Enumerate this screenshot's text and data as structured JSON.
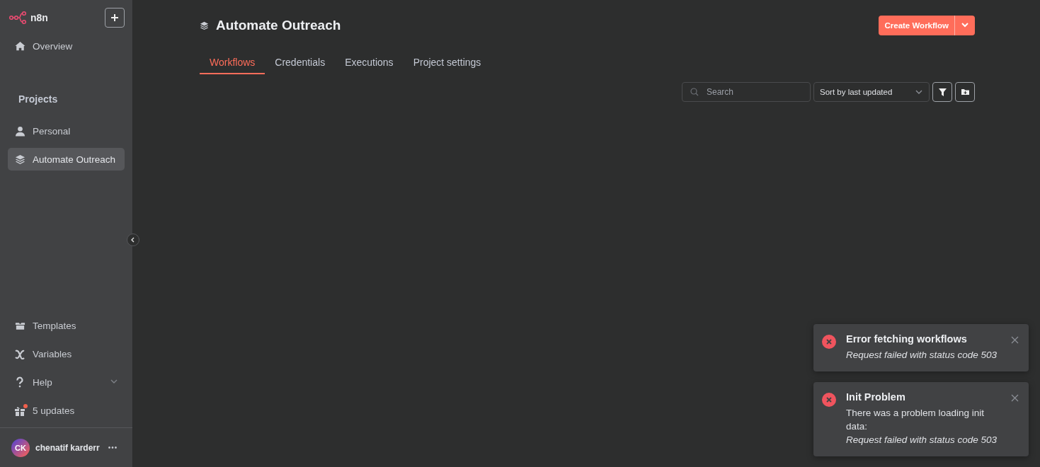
{
  "sidebar": {
    "logo": "n8n",
    "nav": [
      {
        "label": "Overview",
        "selected": false
      }
    ],
    "projects_heading": "Projects",
    "projects": [
      {
        "label": "Personal",
        "selected": false
      },
      {
        "label": "Automate Outreach",
        "selected": true
      }
    ],
    "bottom": [
      {
        "label": "Templates",
        "kind": "link"
      },
      {
        "label": "Variables",
        "kind": "link"
      },
      {
        "label": "Help",
        "kind": "expandable"
      },
      {
        "label": "5 updates",
        "kind": "notify"
      }
    ],
    "user": {
      "initials": "CK",
      "name": "chenatif karderr",
      "more": "•••"
    }
  },
  "header": {
    "title": "Automate Outreach",
    "create_button": "Create Workflow"
  },
  "tabs": [
    {
      "label": "Workflows",
      "selected": true
    },
    {
      "label": "Credentials",
      "selected": false
    },
    {
      "label": "Executions",
      "selected": false
    },
    {
      "label": "Project settings",
      "selected": false
    }
  ],
  "search": {
    "placeholder": "Search"
  },
  "sort": {
    "value": "Sort by last updated"
  },
  "toasts": [
    {
      "title": "Error fetching workflows",
      "detail": "Request failed with status code 503"
    },
    {
      "title": "Init Problem",
      "message": "There was a problem loading init data:",
      "detail": "Request failed with status code 503"
    }
  ]
}
